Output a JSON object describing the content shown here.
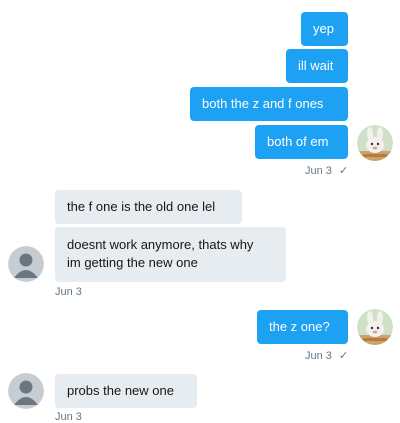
{
  "messages": {
    "out": [
      {
        "text": "yep"
      },
      {
        "text": "ill wait"
      },
      {
        "text": "both the z and f ones"
      },
      {
        "text": "both of em"
      }
    ],
    "out_meta": {
      "date": "Jun 3",
      "status": "✓"
    },
    "in": [
      {
        "text": "the f one is the old one lel"
      },
      {
        "text": "doesnt work anymore, thats why"
      },
      {
        "text": "im getting the new one"
      }
    ],
    "in_meta": {
      "date": "Jun 3"
    },
    "out2": {
      "text": "the z one?"
    },
    "out2_meta": {
      "date": "Jun 3",
      "status": "✓"
    },
    "in2": {
      "text": "probs the new one"
    },
    "in2_meta": {
      "date": "Jun 3"
    }
  },
  "colors": {
    "accent": "#1da1f2",
    "incoming_bg": "#e6ecf0",
    "meta_text": "#657786"
  },
  "icons": {
    "self_avatar": "rabbit-avatar-icon",
    "other_avatar": "default-user-avatar-icon",
    "sent_check": "check-icon"
  }
}
